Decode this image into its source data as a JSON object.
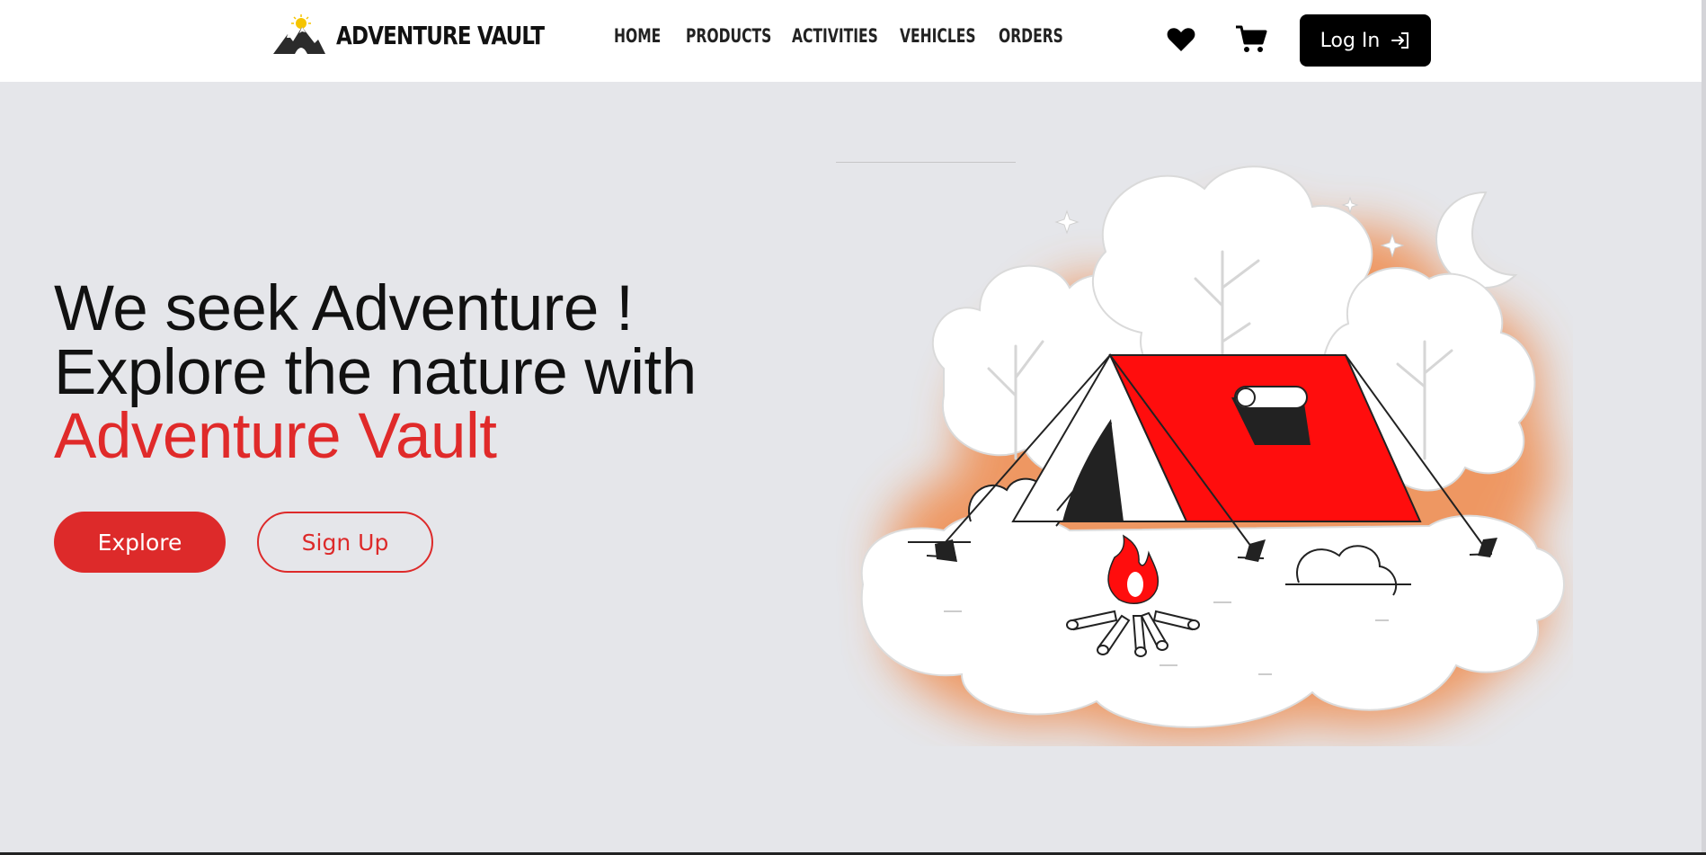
{
  "brand": {
    "name": "ADVENTURE VAULT",
    "logo": "mountain-sun-logo"
  },
  "nav": {
    "items": [
      {
        "label": "HOME"
      },
      {
        "label": "PRODUCTS"
      },
      {
        "label": "ACTIVITIES"
      },
      {
        "label": "VEHICLES"
      },
      {
        "label": "ORDERS"
      }
    ]
  },
  "header_icons": {
    "wishlist": "heart-icon",
    "cart": "cart-icon"
  },
  "auth": {
    "login_label": "Log In",
    "login_icon": "login-arrow-icon"
  },
  "hero": {
    "line1": "We seek Adventure !",
    "line2": "Explore the nature with",
    "line3": "Adventure Vault",
    "explore_label": "Explore",
    "signup_label": "Sign Up"
  },
  "colors": {
    "accent": "#dd2a2a",
    "background": "#e5e6ea",
    "header": "#ffffff",
    "tent_red": "#ff0d0d",
    "glow": "#f08a4b"
  }
}
